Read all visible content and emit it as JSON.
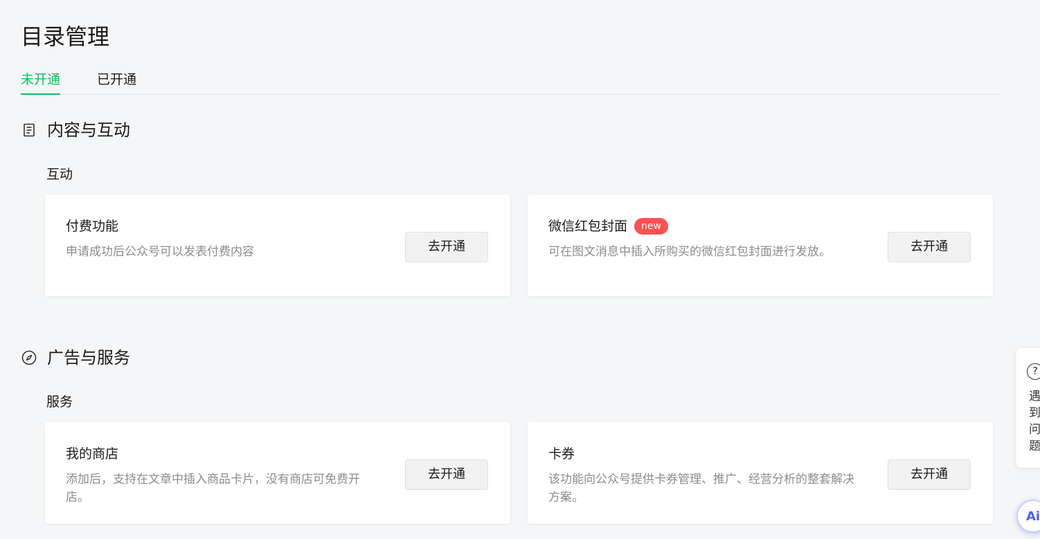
{
  "page_title": "目录管理",
  "tabs": [
    {
      "label": "未开通",
      "active": true
    },
    {
      "label": "已开通",
      "active": false
    }
  ],
  "accent_color": "#07c160",
  "badge_color": "#fa5151",
  "sections": [
    {
      "title": "内容与互动",
      "icon": "document-icon",
      "subsection": "互动",
      "cards": [
        {
          "title": "付费功能",
          "desc": "申请成功后公众号可以发表付费内容",
          "button": "去开通"
        },
        {
          "title": "微信红包封面",
          "badge": "new",
          "desc": "可在图文消息中插入所购买的微信红包封面进行发放。",
          "button": "去开通"
        }
      ]
    },
    {
      "title": "广告与服务",
      "icon": "compass-icon",
      "subsection": "服务",
      "cards": [
        {
          "title": "我的商店",
          "desc": "添加后，支持在文章中插入商品卡片，没有商店可免费开店。",
          "button": "去开通"
        },
        {
          "title": "卡券",
          "desc": "该功能向公众号提供卡券管理、推广、经营分析的整套解决方案。",
          "button": "去开通"
        }
      ]
    }
  ],
  "help_float": {
    "text": "遇到问题",
    "icon": "question-icon"
  },
  "ai_float": {
    "label": "Ai"
  }
}
